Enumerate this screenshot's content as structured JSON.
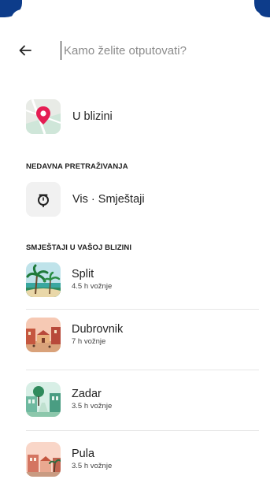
{
  "search": {
    "placeholder": "Kamo želite otputovati?"
  },
  "nearby": {
    "label": "U blizini",
    "icon": "map-pin-icon"
  },
  "recent": {
    "section_title": "NEDAVNA PRETRAŽIVANJA",
    "items": [
      {
        "label": "Vis · Smještaji",
        "icon": "clock-history-icon"
      }
    ]
  },
  "nearby_stays": {
    "section_title": "SMJEŠTAJI U VAŠOJ BLIZINI",
    "items": [
      {
        "name": "Split",
        "subtitle": "4.5 h vožnje",
        "icon": "palm-beach-icon"
      },
      {
        "name": "Dubrovnik",
        "subtitle": "7 h vožnje",
        "icon": "old-town-icon"
      },
      {
        "name": "Zadar",
        "subtitle": "3.5 h vožnje",
        "icon": "city-street-icon"
      },
      {
        "name": "Pula",
        "subtitle": "3.5 h vožnje",
        "icon": "coastal-town-icon"
      }
    ]
  },
  "colors": {
    "accent": "#e51d53",
    "header_blue": "#0d3c8a"
  }
}
